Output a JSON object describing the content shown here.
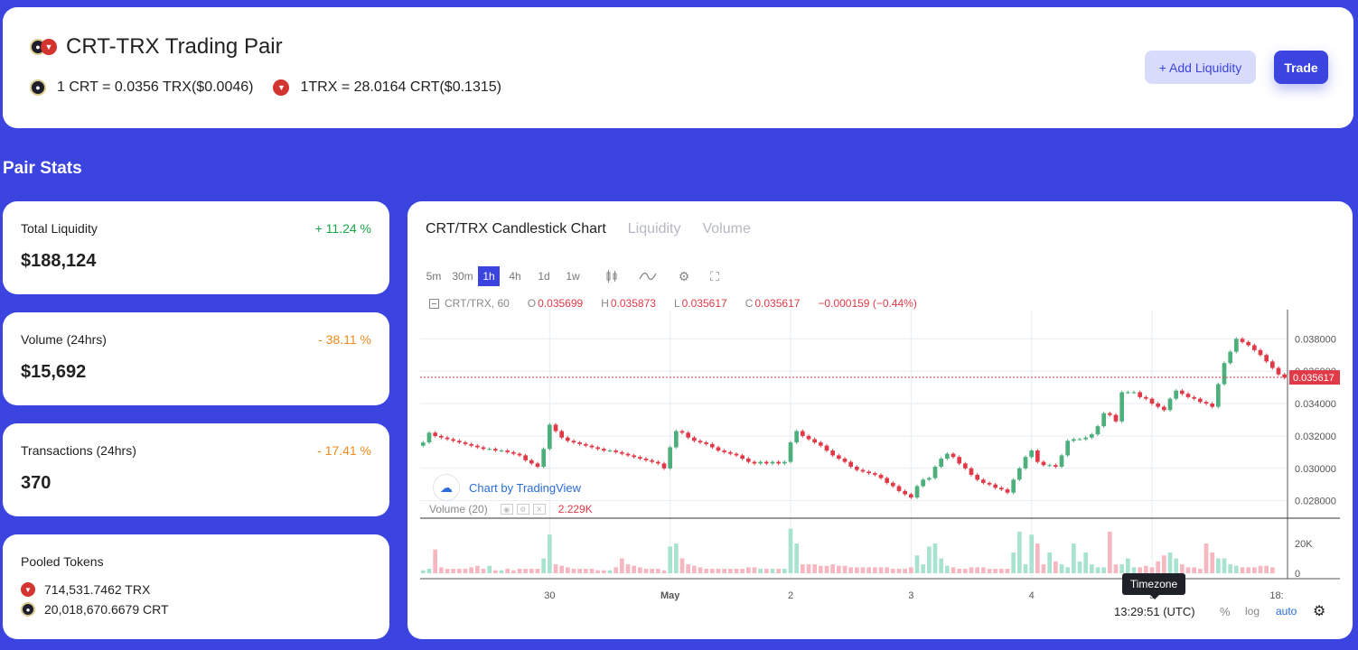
{
  "header": {
    "title": "CRT-TRX Trading Pair",
    "rate_crt": "1 CRT = 0.0356 TRX($0.0046)",
    "rate_trx": "1TRX = 28.0164 CRT($0.1315)",
    "add_liquidity_label": "+ Add Liquidity",
    "trade_label": "Trade"
  },
  "section_title": "Pair Stats",
  "stats": [
    {
      "label": "Total Liquidity",
      "change": "+ 11.24 %",
      "value": "$188,124"
    },
    {
      "label": "Volume (24hrs)",
      "change": "- 38.11 %",
      "value": "$15,692"
    },
    {
      "label": "Transactions (24hrs)",
      "change": "- 17.41 %",
      "value": "370"
    }
  ],
  "pooled": {
    "label": "Pooled Tokens",
    "trx": "714,531.7462 TRX",
    "crt": "20,018,670.6679 CRT"
  },
  "chart_tabs": [
    "CRT/TRX Candlestick Chart",
    "Liquidity",
    "Volume"
  ],
  "intervals": [
    "5m",
    "30m",
    "1h",
    "4h",
    "1d",
    "1w"
  ],
  "active_interval": "1h",
  "ohlc": {
    "symbol": "CRT/TRX, 60",
    "o_key": "O",
    "o": "0.035699",
    "h_key": "H",
    "h": "0.035873",
    "l_key": "L",
    "l": "0.035617",
    "c_key": "C",
    "c": "0.035617",
    "change": "−0.000159 (−0.44%)"
  },
  "tradingview_badge": "Chart by TradingView",
  "volume_label": "Volume (20)",
  "volume_value": "2.229K",
  "timezone_tooltip": "Timezone",
  "time_display": "13:29:51 (UTC)",
  "scale_buttons": {
    "percent": "%",
    "log": "log",
    "auto": "auto"
  },
  "colors": {
    "background": "#3c44e0",
    "up": "#4caf7c",
    "down": "#e03a48",
    "up_text": "#1aa64a",
    "down_text": "#f08a1c"
  },
  "icons": {
    "crt": "crt-coin-icon",
    "trx": "trx-coin-icon",
    "settings": "gear-icon",
    "fullscreen": "fullscreen-icon",
    "indicators": "indicator-icon",
    "candles": "candles-icon"
  },
  "chart_data": {
    "type": "candlestick",
    "price_axis": {
      "ticks": [
        "0.038000",
        "0.036000",
        "0.034000",
        "0.032000",
        "0.030000",
        "0.028000"
      ],
      "last_price": "0.035617",
      "range": [
        0.0272,
        0.0398
      ]
    },
    "volume_axis": {
      "ticks": [
        "20K",
        "0"
      ],
      "range": [
        0,
        34000
      ]
    },
    "x_labels": [
      "30",
      "May",
      "2",
      "3",
      "4",
      "5",
      "18:"
    ],
    "closes": [
      0.0316,
      0.0322,
      0.032,
      0.0319,
      0.0318,
      0.0317,
      0.0316,
      0.0315,
      0.0314,
      0.0313,
      0.0312,
      0.0312,
      0.0311,
      0.0311,
      0.031,
      0.0309,
      0.0308,
      0.0305,
      0.0303,
      0.0301,
      0.0312,
      0.0327,
      0.0323,
      0.0319,
      0.0317,
      0.0316,
      0.0315,
      0.0314,
      0.0313,
      0.0312,
      0.0311,
      0.0311,
      0.031,
      0.0309,
      0.0308,
      0.0307,
      0.0306,
      0.0305,
      0.0304,
      0.0303,
      0.03,
      0.0313,
      0.0323,
      0.0322,
      0.0319,
      0.0317,
      0.0316,
      0.0315,
      0.0313,
      0.0311,
      0.031,
      0.0309,
      0.0308,
      0.0306,
      0.0304,
      0.0303,
      0.0304,
      0.0303,
      0.0304,
      0.0303,
      0.0304,
      0.0316,
      0.0323,
      0.032,
      0.0318,
      0.0316,
      0.0314,
      0.0311,
      0.0308,
      0.0306,
      0.0304,
      0.0301,
      0.0299,
      0.0298,
      0.0297,
      0.0296,
      0.0294,
      0.0291,
      0.0289,
      0.0286,
      0.0284,
      0.0282,
      0.0289,
      0.0293,
      0.0294,
      0.0301,
      0.0306,
      0.0309,
      0.0307,
      0.0303,
      0.03,
      0.0296,
      0.0293,
      0.0291,
      0.029,
      0.0288,
      0.0287,
      0.0285,
      0.0293,
      0.03,
      0.0307,
      0.0311,
      0.0304,
      0.0302,
      0.0302,
      0.0301,
      0.0308,
      0.0317,
      0.0318,
      0.0318,
      0.0319,
      0.0321,
      0.0326,
      0.0334,
      0.0333,
      0.0329,
      0.0347,
      0.0347,
      0.0347,
      0.0344,
      0.0343,
      0.034,
      0.0338,
      0.0336,
      0.0343,
      0.0348,
      0.0346,
      0.0344,
      0.0343,
      0.0341,
      0.034,
      0.0338,
      0.0352,
      0.0365,
      0.0372,
      0.038,
      0.0378,
      0.0376,
      0.0373,
      0.037,
      0.0366,
      0.0362,
      0.0358,
      0.0356
    ],
    "volumes": [
      2,
      3,
      16,
      4,
      3,
      3,
      3,
      3,
      4,
      5,
      3,
      5,
      2,
      2,
      3,
      2,
      3,
      3,
      3,
      3,
      10,
      26,
      6,
      5,
      4,
      3,
      3,
      3,
      3,
      2,
      2,
      2,
      4,
      10,
      6,
      5,
      4,
      3,
      3,
      3,
      2,
      18,
      20,
      10,
      6,
      5,
      4,
      3,
      3,
      3,
      3,
      3,
      3,
      3,
      4,
      4,
      3,
      3,
      3,
      3,
      3,
      30,
      20,
      6,
      6,
      6,
      5,
      5,
      6,
      5,
      5,
      4,
      4,
      4,
      4,
      4,
      4,
      4,
      3,
      3,
      3,
      4,
      12,
      6,
      18,
      20,
      10,
      5,
      4,
      3,
      3,
      4,
      4,
      4,
      3,
      3,
      3,
      3,
      14,
      28,
      6,
      26,
      20,
      6,
      14,
      8,
      6,
      4,
      20,
      8,
      14,
      6,
      4,
      4,
      28,
      6,
      6,
      10,
      4,
      4,
      5,
      4,
      8,
      12,
      14,
      10,
      6,
      4,
      4,
      3,
      20,
      14,
      10,
      10,
      6,
      5,
      4,
      4,
      4,
      5,
      5,
      4
    ]
  }
}
